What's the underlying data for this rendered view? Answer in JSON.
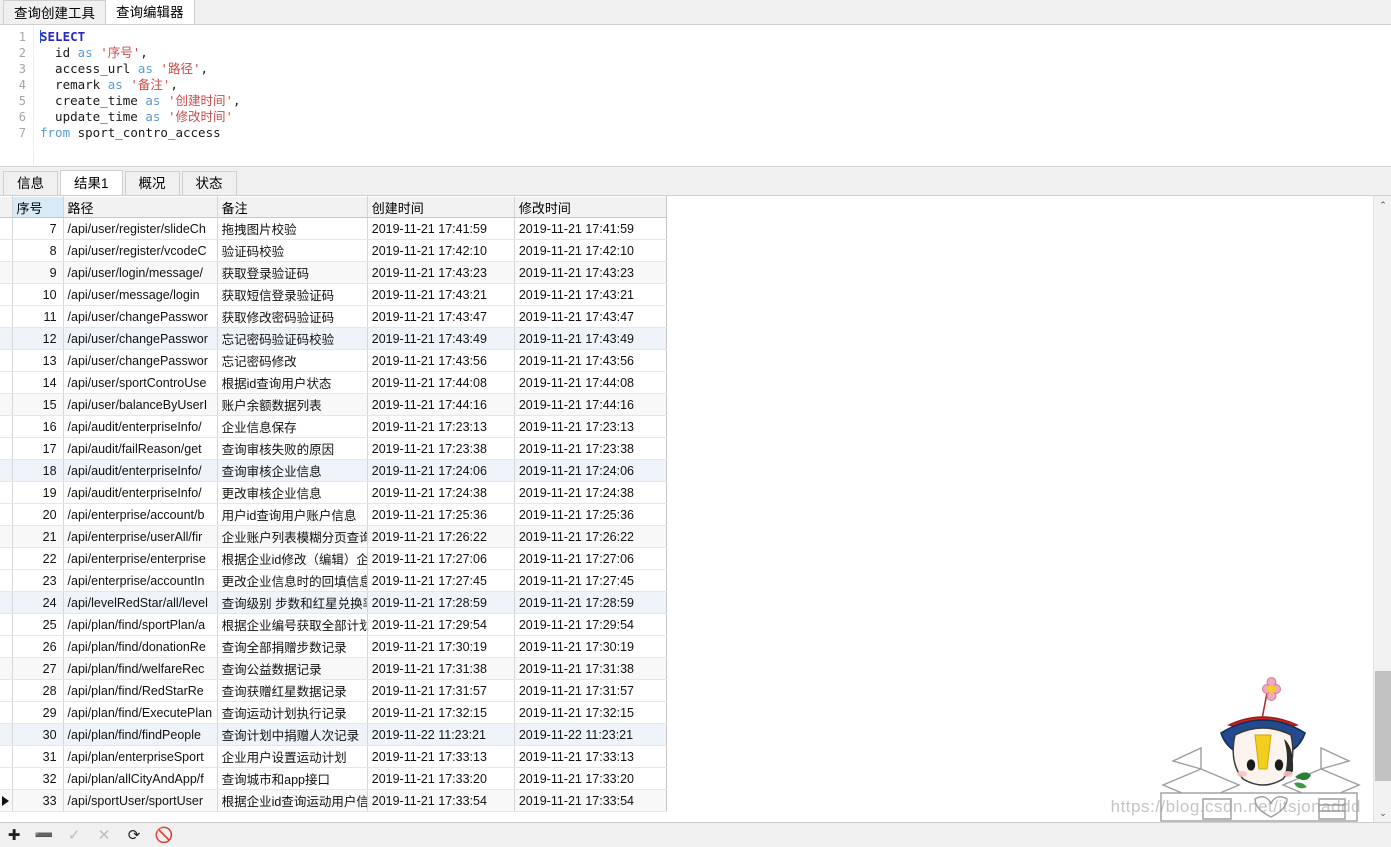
{
  "window": {
    "tabs": [
      {
        "label": "查询创建工具",
        "active": false
      },
      {
        "label": "查询编辑器",
        "active": true
      }
    ]
  },
  "editor": {
    "lines": [
      {
        "num": "1",
        "tokens": [
          {
            "t": "SELECT",
            "c": "kw"
          }
        ]
      },
      {
        "num": "2",
        "tokens": [
          {
            "t": "  id ",
            "c": "ident"
          },
          {
            "t": "as",
            "c": "kw2"
          },
          {
            "t": " ",
            "c": "ident"
          },
          {
            "t": "'序号'",
            "c": "str"
          },
          {
            "t": ",",
            "c": "ident"
          }
        ]
      },
      {
        "num": "3",
        "tokens": [
          {
            "t": "  access_url ",
            "c": "ident"
          },
          {
            "t": "as",
            "c": "kw2"
          },
          {
            "t": " ",
            "c": "ident"
          },
          {
            "t": "'路径'",
            "c": "str"
          },
          {
            "t": ",",
            "c": "ident"
          }
        ]
      },
      {
        "num": "4",
        "tokens": [
          {
            "t": "  remark ",
            "c": "ident"
          },
          {
            "t": "as",
            "c": "kw2"
          },
          {
            "t": " ",
            "c": "ident"
          },
          {
            "t": "'备注'",
            "c": "str"
          },
          {
            "t": ",",
            "c": "ident"
          }
        ]
      },
      {
        "num": "5",
        "tokens": [
          {
            "t": "  create_time ",
            "c": "ident"
          },
          {
            "t": "as",
            "c": "kw2"
          },
          {
            "t": " ",
            "c": "ident"
          },
          {
            "t": "'创建时间'",
            "c": "str"
          },
          {
            "t": ",",
            "c": "ident"
          }
        ]
      },
      {
        "num": "6",
        "tokens": [
          {
            "t": "  update_time ",
            "c": "ident"
          },
          {
            "t": "as",
            "c": "kw2"
          },
          {
            "t": " ",
            "c": "ident"
          },
          {
            "t": "'修改时间'",
            "c": "str"
          }
        ]
      },
      {
        "num": "7",
        "tokens": [
          {
            "t": "from",
            "c": "kw2"
          },
          {
            "t": " sport_contro_access",
            "c": "ident"
          }
        ]
      }
    ]
  },
  "results": {
    "tabs": [
      {
        "label": "信息",
        "active": false
      },
      {
        "label": "结果1",
        "active": true
      },
      {
        "label": "概况",
        "active": false
      },
      {
        "label": "状态",
        "active": false
      }
    ],
    "columns": [
      "序号",
      "路径",
      "备注",
      "创建时间",
      "修改时间"
    ],
    "selected_column": "序号",
    "rows": [
      {
        "id": "7",
        "path": "/api/user/register/slideCh",
        "remark": "拖拽图片校验",
        "create": "2019-11-21 17:41:59",
        "update": "2019-11-21 17:41:59",
        "tint": "none"
      },
      {
        "id": "8",
        "path": "/api/user/register/vcodeC",
        "remark": "验证码校验",
        "create": "2019-11-21 17:42:10",
        "update": "2019-11-21 17:42:10",
        "tint": "none"
      },
      {
        "id": "9",
        "path": "/api/user/login/message/",
        "remark": "获取登录验证码",
        "create": "2019-11-21 17:43:23",
        "update": "2019-11-21 17:43:23",
        "tint": "stripe"
      },
      {
        "id": "10",
        "path": "/api/user/message/login",
        "remark": "获取短信登录验证码",
        "create": "2019-11-21 17:43:21",
        "update": "2019-11-21 17:43:21",
        "tint": "none"
      },
      {
        "id": "11",
        "path": "/api/user/changePasswor",
        "remark": "获取修改密码验证码",
        "create": "2019-11-21 17:43:47",
        "update": "2019-11-21 17:43:47",
        "tint": "none"
      },
      {
        "id": "12",
        "path": "/api/user/changePasswor",
        "remark": "忘记密码验证码校验",
        "create": "2019-11-21 17:43:49",
        "update": "2019-11-21 17:43:49",
        "tint": "blue"
      },
      {
        "id": "13",
        "path": "/api/user/changePasswor",
        "remark": "忘记密码修改",
        "create": "2019-11-21 17:43:56",
        "update": "2019-11-21 17:43:56",
        "tint": "none"
      },
      {
        "id": "14",
        "path": "/api/user/sportControUse",
        "remark": "根据id查询用户状态",
        "create": "2019-11-21 17:44:08",
        "update": "2019-11-21 17:44:08",
        "tint": "none"
      },
      {
        "id": "15",
        "path": "/api/user/balanceByUserI",
        "remark": "账户余额数据列表",
        "create": "2019-11-21 17:44:16",
        "update": "2019-11-21 17:44:16",
        "tint": "stripe"
      },
      {
        "id": "16",
        "path": "/api/audit/enterpriseInfo/",
        "remark": "企业信息保存",
        "create": "2019-11-21 17:23:13",
        "update": "2019-11-21 17:23:13",
        "tint": "none"
      },
      {
        "id": "17",
        "path": "/api/audit/failReason/get",
        "remark": "查询审核失败的原因",
        "create": "2019-11-21 17:23:38",
        "update": "2019-11-21 17:23:38",
        "tint": "none"
      },
      {
        "id": "18",
        "path": "/api/audit/enterpriseInfo/",
        "remark": "查询审核企业信息",
        "create": "2019-11-21 17:24:06",
        "update": "2019-11-21 17:24:06",
        "tint": "blue"
      },
      {
        "id": "19",
        "path": "/api/audit/enterpriseInfo/",
        "remark": "更改审核企业信息",
        "create": "2019-11-21 17:24:38",
        "update": "2019-11-21 17:24:38",
        "tint": "none"
      },
      {
        "id": "20",
        "path": "/api/enterprise/account/b",
        "remark": "用户id查询用户账户信息",
        "create": "2019-11-21 17:25:36",
        "update": "2019-11-21 17:25:36",
        "tint": "none"
      },
      {
        "id": "21",
        "path": "/api/enterprise/userAll/fir",
        "remark": "企业账户列表模糊分页查询",
        "create": "2019-11-21 17:26:22",
        "update": "2019-11-21 17:26:22",
        "tint": "stripe"
      },
      {
        "id": "22",
        "path": "/api/enterprise/enterprise",
        "remark": "根据企业id修改（编辑）企",
        "create": "2019-11-21 17:27:06",
        "update": "2019-11-21 17:27:06",
        "tint": "none"
      },
      {
        "id": "23",
        "path": "/api/enterprise/accountIn",
        "remark": "更改企业信息时的回填信息",
        "create": "2019-11-21 17:27:45",
        "update": "2019-11-21 17:27:45",
        "tint": "none"
      },
      {
        "id": "24",
        "path": "/api/levelRedStar/all/level",
        "remark": "查询级别 步数和红星兑换率",
        "create": "2019-11-21 17:28:59",
        "update": "2019-11-21 17:28:59",
        "tint": "blue"
      },
      {
        "id": "25",
        "path": "/api/plan/find/sportPlan/a",
        "remark": "根据企业编号获取全部计划",
        "create": "2019-11-21 17:29:54",
        "update": "2019-11-21 17:29:54",
        "tint": "none"
      },
      {
        "id": "26",
        "path": "/api/plan/find/donationRe",
        "remark": "查询全部捐赠步数记录",
        "create": "2019-11-21 17:30:19",
        "update": "2019-11-21 17:30:19",
        "tint": "none"
      },
      {
        "id": "27",
        "path": "/api/plan/find/welfareRec",
        "remark": "查询公益数据记录",
        "create": "2019-11-21 17:31:38",
        "update": "2019-11-21 17:31:38",
        "tint": "stripe"
      },
      {
        "id": "28",
        "path": "/api/plan/find/RedStarRe",
        "remark": "查询获赠红星数据记录",
        "create": "2019-11-21 17:31:57",
        "update": "2019-11-21 17:31:57",
        "tint": "none"
      },
      {
        "id": "29",
        "path": "/api/plan/find/ExecutePlan",
        "remark": "查询运动计划执行记录",
        "create": "2019-11-21 17:32:15",
        "update": "2019-11-21 17:32:15",
        "tint": "none"
      },
      {
        "id": "30",
        "path": "/api/plan/find/findPeople",
        "remark": "查询计划中捐赠人次记录",
        "create": "2019-11-22 11:23:21",
        "update": "2019-11-22 11:23:21",
        "tint": "blue"
      },
      {
        "id": "31",
        "path": "/api/plan/enterpriseSport",
        "remark": "企业用户设置运动计划",
        "create": "2019-11-21 17:33:13",
        "update": "2019-11-21 17:33:13",
        "tint": "none"
      },
      {
        "id": "32",
        "path": "/api/plan/allCityAndApp/f",
        "remark": "查询城市和app接口",
        "create": "2019-11-21 17:33:20",
        "update": "2019-11-21 17:33:20",
        "tint": "none"
      },
      {
        "id": "33",
        "path": "/api/sportUser/sportUser",
        "remark": "根据企业id查询运动用户信",
        "create": "2019-11-21 17:33:54",
        "update": "2019-11-21 17:33:54",
        "tint": "stripe",
        "current": true
      }
    ]
  },
  "bottom_toolbar": {
    "buttons": [
      {
        "name": "add-record-button",
        "glyph": "✚",
        "enabled": true
      },
      {
        "name": "delete-record-button",
        "glyph": "➖",
        "enabled": true
      },
      {
        "name": "apply-change-button",
        "glyph": "✓",
        "enabled": false
      },
      {
        "name": "cancel-change-button",
        "glyph": "✕",
        "enabled": false
      },
      {
        "name": "refresh-button",
        "glyph": "⟳",
        "enabled": true
      },
      {
        "name": "stop-button",
        "glyph": "🚫",
        "enabled": true
      }
    ]
  },
  "scrollbar": {
    "up_arrow": "⌃",
    "down_arrow": "⌄"
  },
  "watermark": {
    "text": "https://blog.csdn.net/itsjonaddd"
  },
  "colors": {
    "keyword": "#2727c4",
    "keyword_secondary": "#5a9bd5",
    "string": "#cc4b4b",
    "selected_header": "#d9eaf7",
    "row_stripe": "#f8f8f8",
    "row_blue": "#eff4fa"
  }
}
